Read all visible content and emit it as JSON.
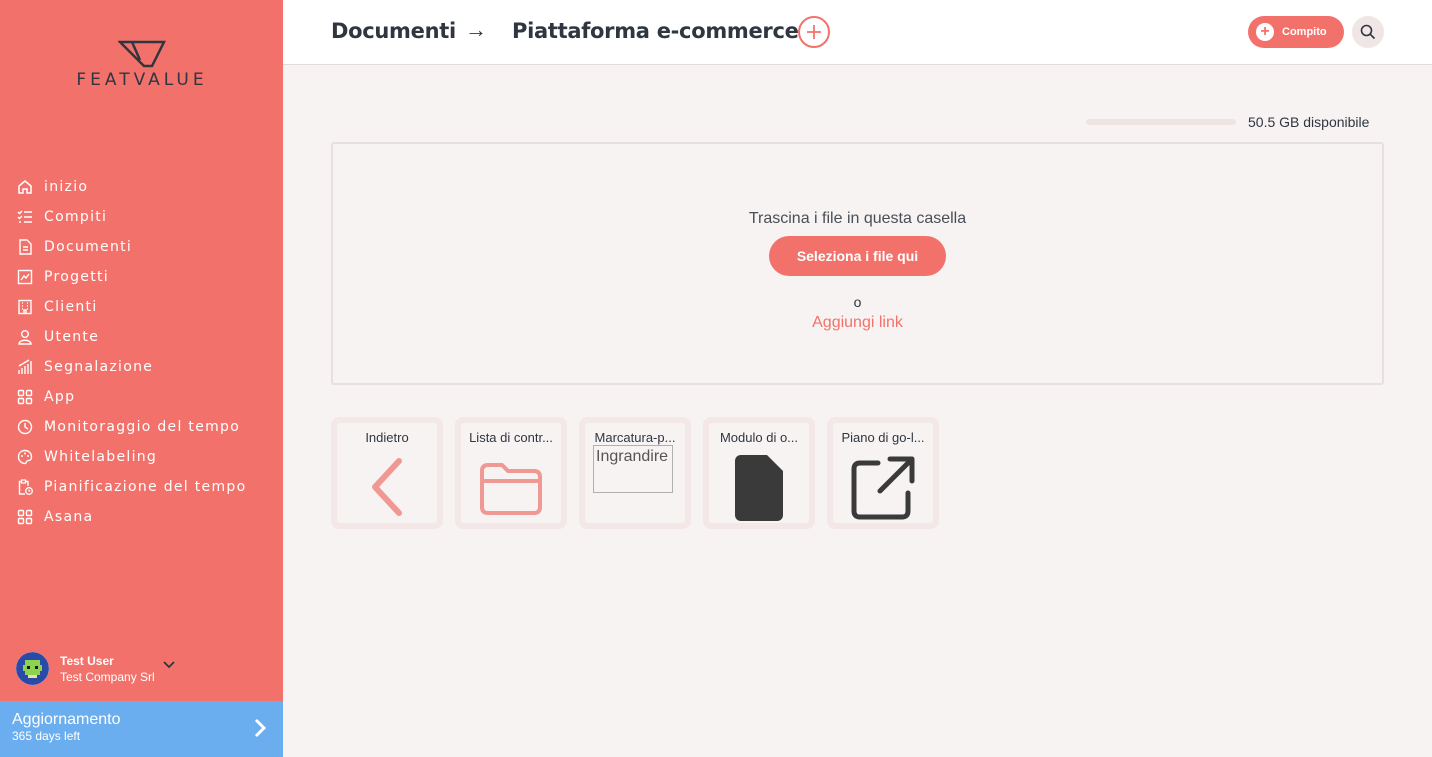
{
  "brand": {
    "logo_text": "FEATVALUE"
  },
  "sidebar": {
    "items": [
      {
        "label": "inizio",
        "icon": "home-icon"
      },
      {
        "label": "Compiti",
        "icon": "checklist-icon"
      },
      {
        "label": "Documenti",
        "icon": "document-icon"
      },
      {
        "label": "Progetti",
        "icon": "chart-icon"
      },
      {
        "label": "Clienti",
        "icon": "building-icon"
      },
      {
        "label": "Utente",
        "icon": "user-icon"
      },
      {
        "label": "Segnalazione",
        "icon": "bar-chart-icon"
      },
      {
        "label": "App",
        "icon": "apps-icon"
      },
      {
        "label": "Monitoraggio del tempo",
        "icon": "timer-icon"
      },
      {
        "label": "Whitelabeling",
        "icon": "palette-icon"
      },
      {
        "label": "Pianificazione del tempo",
        "icon": "clipboard-clock-icon"
      },
      {
        "label": "Asana",
        "icon": "apps-icon"
      }
    ],
    "user": {
      "name": "Test User",
      "company": "Test Company Srl"
    },
    "upgrade": {
      "title": "Aggiornamento",
      "subtitle": "365 days left"
    }
  },
  "header": {
    "breadcrumb_root": "Documenti",
    "breadcrumb_arrow": "→",
    "breadcrumb_current": "Piattaforma e-commerce",
    "task_button": "Compito"
  },
  "storage": {
    "text": "50.5 GB disponibile"
  },
  "dropzone": {
    "instruction": "Trascina i file in questa casella",
    "select_button": "Seleziona i file qui",
    "or": "o",
    "add_link": "Aggiungi link"
  },
  "tiles": [
    {
      "label": "Indietro",
      "icon": "chevron-left-icon"
    },
    {
      "label": "Lista di contr...",
      "icon": "folder-icon"
    },
    {
      "label": "Marcatura-p...",
      "icon": "broken-image-icon",
      "alt": "Ingrandire"
    },
    {
      "label": "Modulo di o...",
      "icon": "file-icon"
    },
    {
      "label": "Piano di go-l...",
      "icon": "external-link-icon"
    }
  ],
  "colors": {
    "accent": "#f2726b",
    "upgrade": "#6aaef0",
    "text": "#2f3640",
    "background": "#f7f3f2"
  }
}
